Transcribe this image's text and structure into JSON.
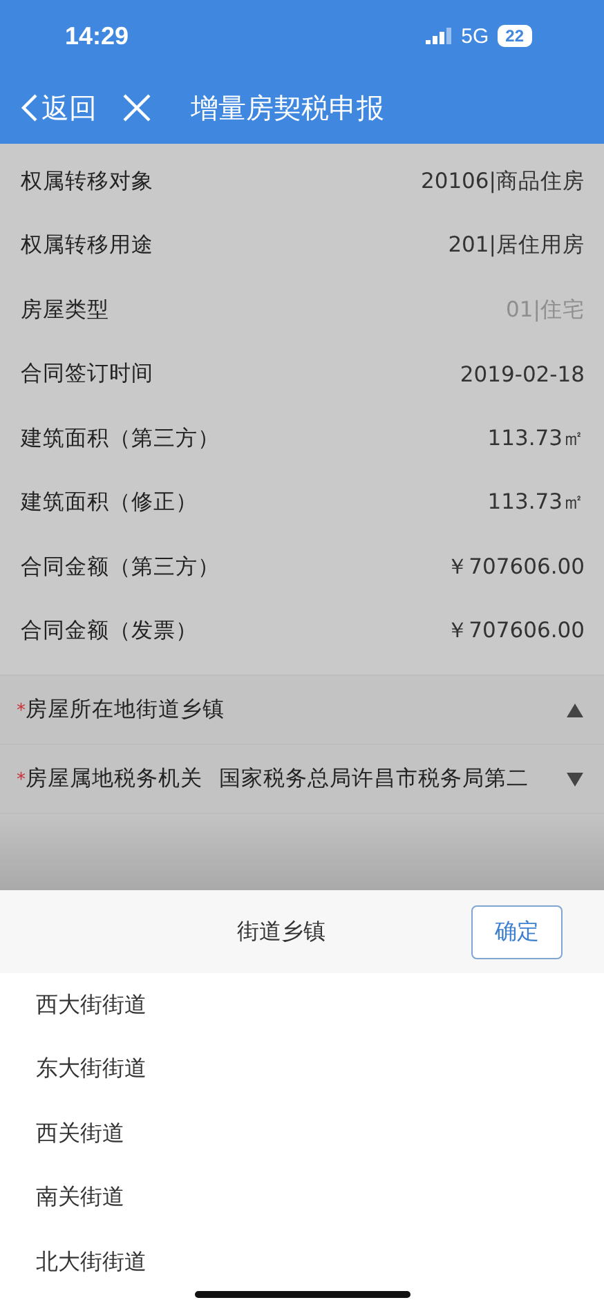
{
  "status_bar": {
    "time": "14:29",
    "network": "5G",
    "battery": "22"
  },
  "nav": {
    "back": "返回",
    "title": "增量房契税申报"
  },
  "fields": [
    {
      "label": "权属转移对象",
      "value": "20106|商品住房",
      "disabled": false
    },
    {
      "label": "权属转移用途",
      "value": "201|居住用房",
      "disabled": false
    },
    {
      "label": "房屋类型",
      "value": "01|住宅",
      "disabled": true
    },
    {
      "label": "合同签订时间",
      "value": "2019-02-18",
      "disabled": false
    },
    {
      "label": "建筑面积（第三方）",
      "value": "113.73㎡",
      "disabled": false
    },
    {
      "label": "建筑面积（修正）",
      "value": "113.73㎡",
      "disabled": false
    },
    {
      "label": "合同金额（第三方）",
      "value": "￥707606.00",
      "disabled": false
    },
    {
      "label": "合同金额（发票）",
      "value": "￥707606.00",
      "disabled": false
    }
  ],
  "selects": [
    {
      "required_mark": "*",
      "label": "房屋所在地街道乡镇",
      "expanded": true
    },
    {
      "required_mark": "*",
      "label": "房屋属地税务机关",
      "value": "国家税务总局许昌市税务局第二",
      "expanded": false
    }
  ],
  "picker": {
    "title": "街道乡镇",
    "confirm": "确定",
    "options": [
      "西大街街道",
      "东大街街道",
      "西关街道",
      "南关街道",
      "北大街街道"
    ]
  }
}
